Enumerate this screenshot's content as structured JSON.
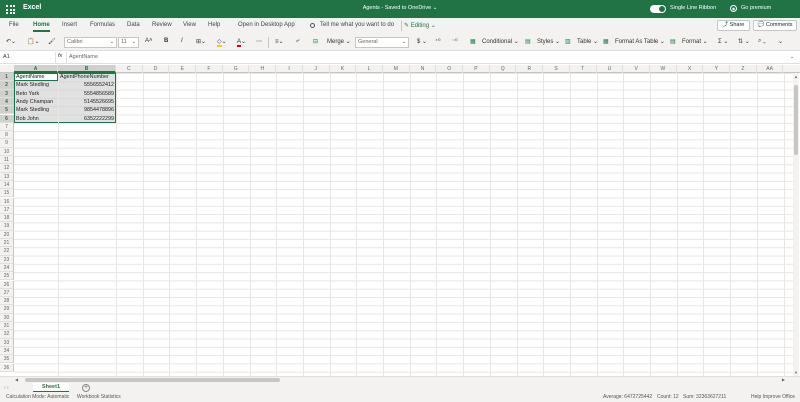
{
  "titlebar": {
    "app_name": "Excel",
    "document_title": "Agents - Saved to OneDrive ⌄",
    "single_line_ribbon_label": "Single Line Ribbon",
    "single_line_ribbon_on": true,
    "premium_label": "Go premium"
  },
  "menu": {
    "tabs": [
      "File",
      "Home",
      "Insert",
      "Formulas",
      "Data",
      "Review",
      "View",
      "Help"
    ],
    "active_tab": "Home",
    "open_desktop": "Open in Desktop App",
    "tell_me": "Tell me what you want to do",
    "editing": "Editing ⌄",
    "share": "Share",
    "comments": "Comments"
  },
  "ribbon": {
    "font_name": "Calibri",
    "font_size": "11",
    "bold": "B",
    "italic": "I",
    "more": "⋯",
    "merge": "Merge ⌄",
    "number_format": "General",
    "currency": "$ ⌄",
    "conditional": "Conditional ⌄",
    "styles": "Styles ⌄",
    "table": "Table ⌄",
    "format_as_table": "Format As Table ⌄",
    "format": "Format ⌄",
    "sum": "Σ ⌄",
    "sort": "⇅ ⌄",
    "find": "⌕ ⌄"
  },
  "formula_bar": {
    "name_box": "A1",
    "fx": "fx",
    "value": "AgentName"
  },
  "grid": {
    "columns": [
      "A",
      "B",
      "C",
      "D",
      "E",
      "F",
      "G",
      "H",
      "I",
      "J",
      "K",
      "L",
      "M",
      "N",
      "O",
      "P",
      "Q",
      "R",
      "S",
      "T",
      "U",
      "V",
      "W",
      "X",
      "Y",
      "Z",
      "AA"
    ],
    "selected_columns": [
      "A",
      "B"
    ],
    "row_count": 36,
    "selected_rows": [
      1,
      2,
      3,
      4,
      5,
      6
    ],
    "cells": [
      [
        "AgentName",
        "AgentPhoneNumber"
      ],
      [
        "Mark Stedling",
        "5556552412"
      ],
      [
        "Beto Yark",
        "5554856589"
      ],
      [
        "Andy Champan",
        "5145526695"
      ],
      [
        "Mark Stedling",
        "9854478896"
      ],
      [
        "Bob John",
        "6352222299"
      ]
    ]
  },
  "sheets": {
    "tabs": [
      "Sheet1"
    ],
    "active": "Sheet1",
    "add": "+"
  },
  "status": {
    "calc_mode": "Calculation Mode: Automatic",
    "workbook_stats": "Workbook Statistics",
    "average": "Average: 6472725442",
    "count": "Count: 12",
    "sum": "Sum: 32363627211",
    "help": "Help Improve Office"
  },
  "colors": {
    "brand": "#217346",
    "ribbon_bg": "#f3f2f1"
  }
}
